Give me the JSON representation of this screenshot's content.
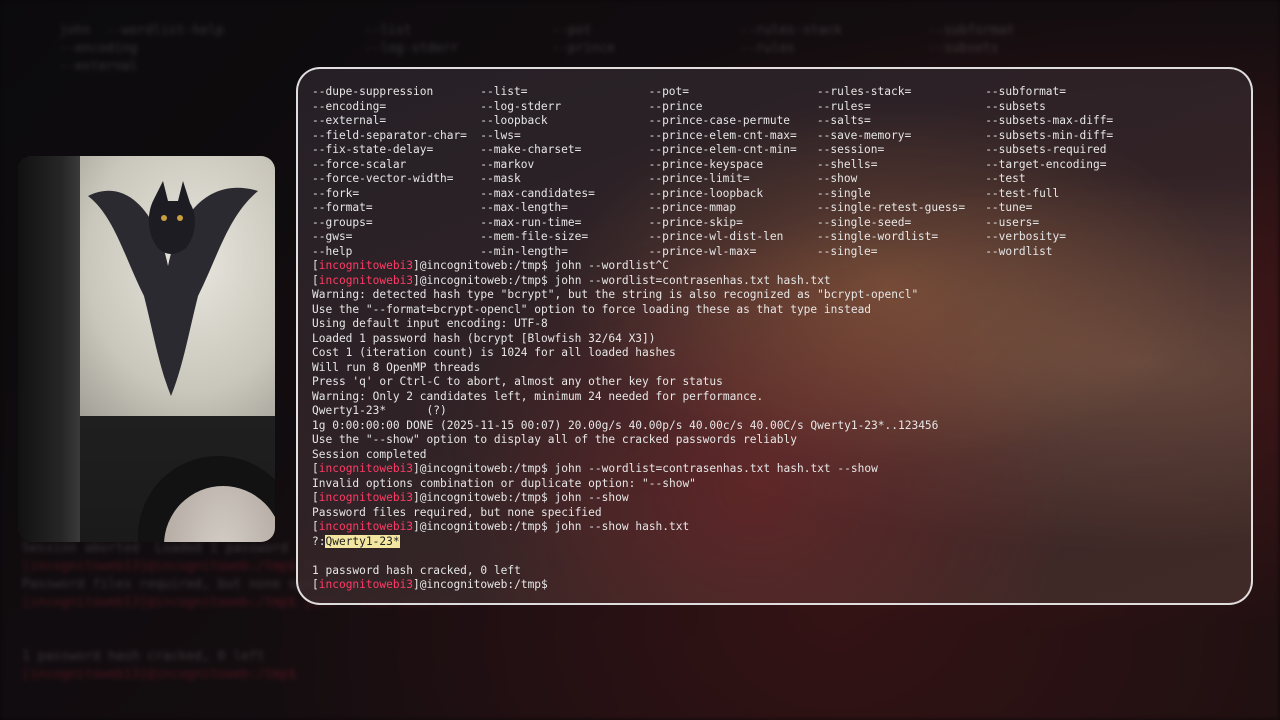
{
  "background": {
    "ghost_lines": [
      "    john  --wordlist-help                  --list                  --pot                   --rules-stack           --subformat",
      "    --encoding                             --log-stderr            --prince                --rules                 --subsets",
      "    --external"
    ],
    "ghost_bottom": [
      "Session aborted  Loaded 1 password",
      "[incognitoweb13]@incognitoweb:/tmp$ john",
      "Password files required, but none specified",
      "[incognitoweb13]@incognitoweb:/tmp$ john --show hash.txt",
      "",
      "",
      "1 password hash cracked, 0 left",
      "[incognitoweb13]@incognitoweb:/tmp$"
    ]
  },
  "terminal": {
    "options": [
      [
        "--dupe-suppression",
        "--list=",
        "--pot=",
        "--rules-stack=",
        "--subformat="
      ],
      [
        "--encoding=",
        "--log-stderr",
        "--prince",
        "--rules=",
        "--subsets"
      ],
      [
        "--external=",
        "--loopback",
        "--prince-case-permute",
        "--salts=",
        "--subsets-max-diff="
      ],
      [
        "--field-separator-char=",
        "--lws=",
        "--prince-elem-cnt-max=",
        "--save-memory=",
        "--subsets-min-diff="
      ],
      [
        "--fix-state-delay=",
        "--make-charset=",
        "--prince-elem-cnt-min=",
        "--session=",
        "--subsets-required"
      ],
      [
        "--force-scalar",
        "--markov",
        "--prince-keyspace",
        "--shells=",
        "--target-encoding="
      ],
      [
        "--force-vector-width=",
        "--mask",
        "--prince-limit=",
        "--show",
        "--test"
      ],
      [
        "--fork=",
        "--max-candidates=",
        "--prince-loopback",
        "--single",
        "--test-full"
      ],
      [
        "--format=",
        "--max-length=",
        "--prince-mmap",
        "--single-retest-guess=",
        "--tune="
      ],
      [
        "--groups=",
        "--max-run-time=",
        "--prince-skip=",
        "--single-seed=",
        "--users="
      ],
      [
        "--gws=",
        "--mem-file-size=",
        "--prince-wl-dist-len",
        "--single-wordlist=",
        "--verbosity="
      ],
      [
        "--help",
        "--min-length=",
        "--prince-wl-max=",
        "--single=",
        "--wordlist"
      ]
    ],
    "prompt_user": "incognitowebi3",
    "prompt_host": "@incognitoweb:/tmp$",
    "lines": [
      {
        "type": "prompt",
        "cmd": " john --wordlist^C"
      },
      {
        "type": "prompt",
        "cmd": " john --wordlist=contrasenhas.txt hash.txt"
      },
      {
        "type": "text",
        "text": "Warning: detected hash type \"bcrypt\", but the string is also recognized as \"bcrypt-opencl\""
      },
      {
        "type": "text",
        "text": "Use the \"--format=bcrypt-opencl\" option to force loading these as that type instead"
      },
      {
        "type": "text",
        "text": "Using default input encoding: UTF-8"
      },
      {
        "type": "text",
        "text": "Loaded 1 password hash (bcrypt [Blowfish 32/64 X3])"
      },
      {
        "type": "text",
        "text": "Cost 1 (iteration count) is 1024 for all loaded hashes"
      },
      {
        "type": "text",
        "text": "Will run 8 OpenMP threads"
      },
      {
        "type": "text",
        "text": "Press 'q' or Ctrl-C to abort, almost any other key for status"
      },
      {
        "type": "text",
        "text": "Warning: Only 2 candidates left, minimum 24 needed for performance."
      },
      {
        "type": "text",
        "text": "Qwerty1-23*      (?)"
      },
      {
        "type": "text",
        "text": "1g 0:00:00:00 DONE (2025-11-15 00:07) 20.00g/s 40.00p/s 40.00c/s 40.00C/s Qwerty1-23*..123456"
      },
      {
        "type": "text",
        "text": "Use the \"--show\" option to display all of the cracked passwords reliably"
      },
      {
        "type": "text",
        "text": "Session completed"
      },
      {
        "type": "prompt",
        "cmd": " john --wordlist=contrasenhas.txt hash.txt --show"
      },
      {
        "type": "text",
        "text": "Invalid options combination or duplicate option: \"--show\""
      },
      {
        "type": "prompt",
        "cmd": " john --show"
      },
      {
        "type": "text",
        "text": "Password files required, but none specified"
      },
      {
        "type": "prompt",
        "cmd": " john --show hash.txt"
      },
      {
        "type": "result",
        "prefix": "?:",
        "value": "Qwerty1-23*"
      },
      {
        "type": "text",
        "text": ""
      },
      {
        "type": "text",
        "text": "1 password hash cracked, 0 left"
      },
      {
        "type": "prompt",
        "cmd": ""
      }
    ]
  },
  "colors": {
    "prompt_user": "#ff3b66",
    "highlight_bg": "#f3e6a0",
    "text": "#e6e6e6"
  }
}
